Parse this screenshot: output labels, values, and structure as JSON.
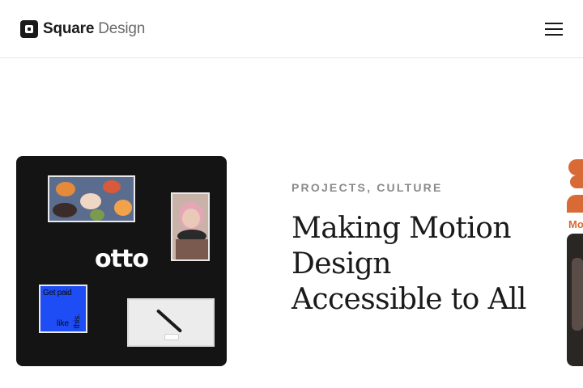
{
  "header": {
    "logo_brand": "Square",
    "logo_product": "Design",
    "menu_icon": "hamburger-icon"
  },
  "featured": {
    "categories": [
      "PROJECTS",
      "CULTURE"
    ],
    "category_separator": ", ",
    "title": "Making Motion Design Accessible to All",
    "image": {
      "logo_text": "otto",
      "tile_getpaid_line1": "Get paid",
      "tile_getpaid_line2": "like",
      "tile_getpaid_line3": "this."
    }
  },
  "next_card": {
    "text_fragment": "Mo"
  },
  "colors": {
    "accent_blue": "#1e4cf5",
    "card_background": "#141414",
    "accent_orange": "#d86a35",
    "category_grey": "#8a8a8a"
  }
}
